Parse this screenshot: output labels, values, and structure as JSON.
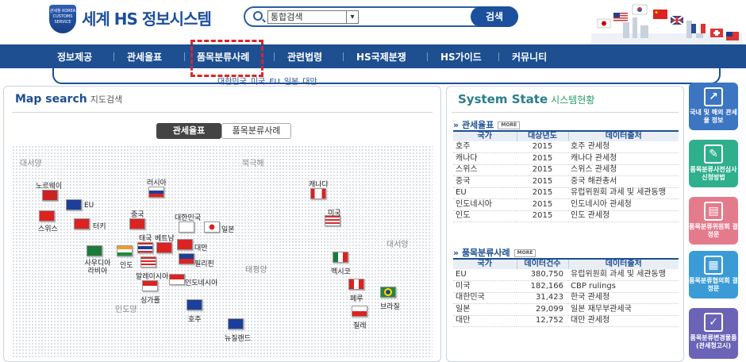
{
  "header": {
    "logo_text": "세계 HS 정보시스템",
    "emblem_text": "관세청 KOREA CUSTOMS SERVICE",
    "search_select": "통합검색",
    "search_button": "검색"
  },
  "nav": {
    "items": [
      "정보제공",
      "관세율표",
      "품목분류사례",
      "관련법령",
      "HS국제분쟁",
      "HS가이드",
      "커뮤니티"
    ]
  },
  "subnav": {
    "items": [
      "대한민국",
      "미국",
      "EU",
      "일본",
      "대만"
    ]
  },
  "map": {
    "title": "Map search",
    "title_kr": "지도검색",
    "tab_active": "관세율표",
    "tab_inactive": "품목분류사례",
    "oceans": [
      "대서양",
      "북극해",
      "태평양",
      "인도양",
      "대서양"
    ],
    "countries": [
      "노르웨이",
      "EU",
      "스위스",
      "터키",
      "러시아",
      "중국",
      "대한민국",
      "일본",
      "태국",
      "베트남",
      "대만",
      "사우디아라비아",
      "인도",
      "필리핀",
      "말레이시아",
      "인도네시아",
      "싱가폴",
      "호주",
      "뉴질랜드",
      "캐나다",
      "미국",
      "멕시코",
      "페루",
      "브라질",
      "칠레"
    ]
  },
  "state": {
    "title": "System State",
    "title_kr": "시스템현황",
    "more": "MORE",
    "tariff": {
      "label": "관세율표",
      "headers": [
        "국가",
        "대상년도",
        "데이터출처"
      ],
      "rows": [
        [
          "호주",
          "2015",
          "호주 관세청"
        ],
        [
          "캐나다",
          "2015",
          "캐나다 관세청"
        ],
        [
          "스위스",
          "2015",
          "스위스 관세청"
        ],
        [
          "중국",
          "2015",
          "중국 해관총서"
        ],
        [
          "EU",
          "2015",
          "유럽위원회 과세 및 세관동맹"
        ],
        [
          "인도네시아",
          "2015",
          "인도네시아 관세청"
        ],
        [
          "인도",
          "2015",
          "인도 관세청"
        ]
      ]
    },
    "rulings": {
      "label": "품목분류사례",
      "headers": [
        "국가",
        "데이터건수",
        "데이터출처"
      ],
      "rows": [
        [
          "EU",
          "380,750",
          "유럽위원회 과세 및 세관동맹"
        ],
        [
          "미국",
          "182,166",
          "CBP rulings"
        ],
        [
          "대한민국",
          "31,423",
          "한국 관세청"
        ],
        [
          "일본",
          "29,099",
          "일본 재무부관세국"
        ],
        [
          "대만",
          "12,752",
          "대만 관세청"
        ]
      ]
    }
  },
  "quick": {
    "items": [
      "국내 및 해외 관세율 정보",
      "품목분류사전심사 신청방법",
      "품목분류위원회 결정문",
      "품목분류협의회 결정문",
      "품목분류변경물품 (관세청고시)"
    ]
  },
  "colors": {
    "nav": "#1d4f91",
    "highlight": "#d9262a",
    "state_title": "#2a7e8c"
  }
}
